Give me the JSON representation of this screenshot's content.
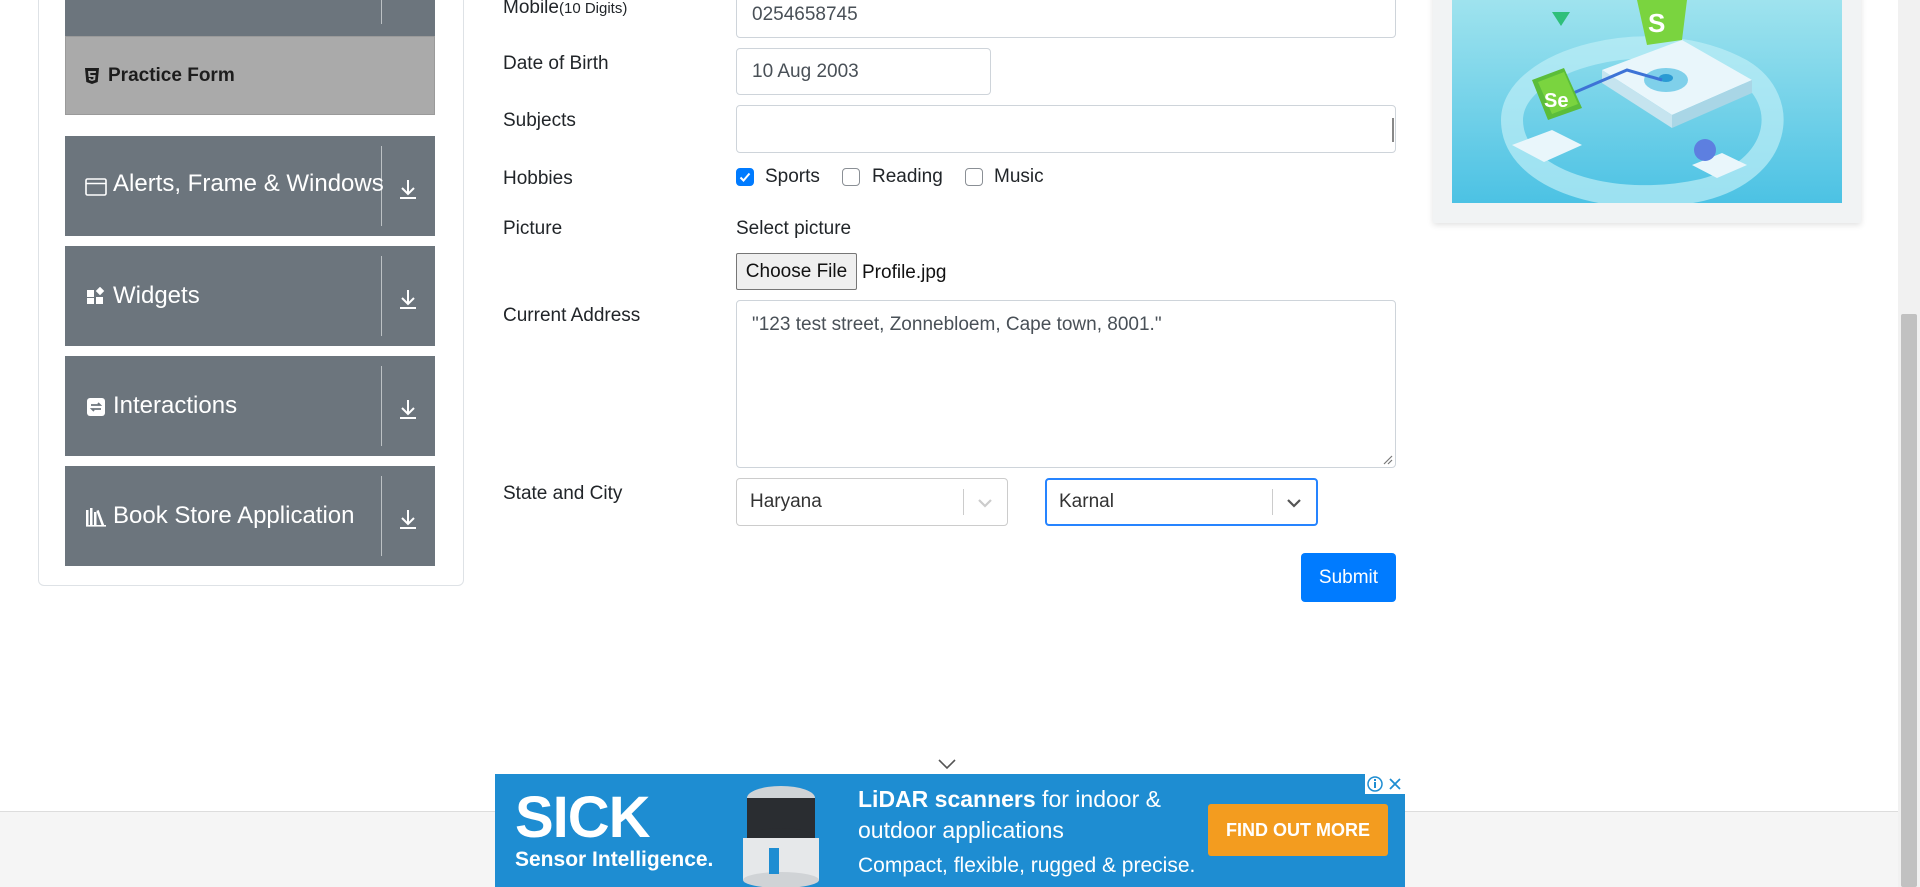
{
  "sidebar": {
    "practice_form_label": "Practice Form",
    "groups": [
      {
        "label": "Alerts, Frame & Windows",
        "icon": "browser-window-icon"
      },
      {
        "label": "Widgets",
        "icon": "widgets-grid-icon"
      },
      {
        "label": "Interactions",
        "icon": "interactions-arrows-icon"
      },
      {
        "label": "Book Store Application",
        "icon": "books-icon"
      }
    ]
  },
  "form": {
    "mobile_label": "Mobile",
    "mobile_hint": "(10 Digits)",
    "mobile_value": "0254658745",
    "dob_label": "Date of Birth",
    "dob_value": "10 Aug 2003",
    "subjects_label": "Subjects",
    "subjects_value": "",
    "hobbies_label": "Hobbies",
    "hobbies": [
      {
        "label": "Sports",
        "checked": true
      },
      {
        "label": "Reading",
        "checked": false
      },
      {
        "label": "Music",
        "checked": false
      }
    ],
    "picture_label": "Picture",
    "select_picture_label": "Select picture",
    "choose_file_label": "Choose File",
    "file_name": "Profile.jpg",
    "address_label": "Current Address",
    "address_value": "\"123 test street, Zonnebloem, Cape town, 8001.\"",
    "state_city_label": "State and City",
    "state_value": "Haryana",
    "city_value": "Karnal",
    "submit_label": "Submit"
  },
  "ad": {
    "brand": "SICK",
    "tagline": "Sensor Intelligence.",
    "headline_bold": "LiDAR scanners",
    "headline_rest": " for indoor &",
    "headline_line2": "outdoor applications",
    "subline": "Compact, flexible, rugged & precise.",
    "cta_label": "FIND OUT MORE",
    "device_label": "SICK"
  },
  "colors": {
    "primary": "#007bff",
    "sidebar_group": "#6c757d",
    "sidebar_active": "#aaaaaa",
    "ad_background": "#1e8dd2",
    "ad_cta": "#f39c1f"
  }
}
